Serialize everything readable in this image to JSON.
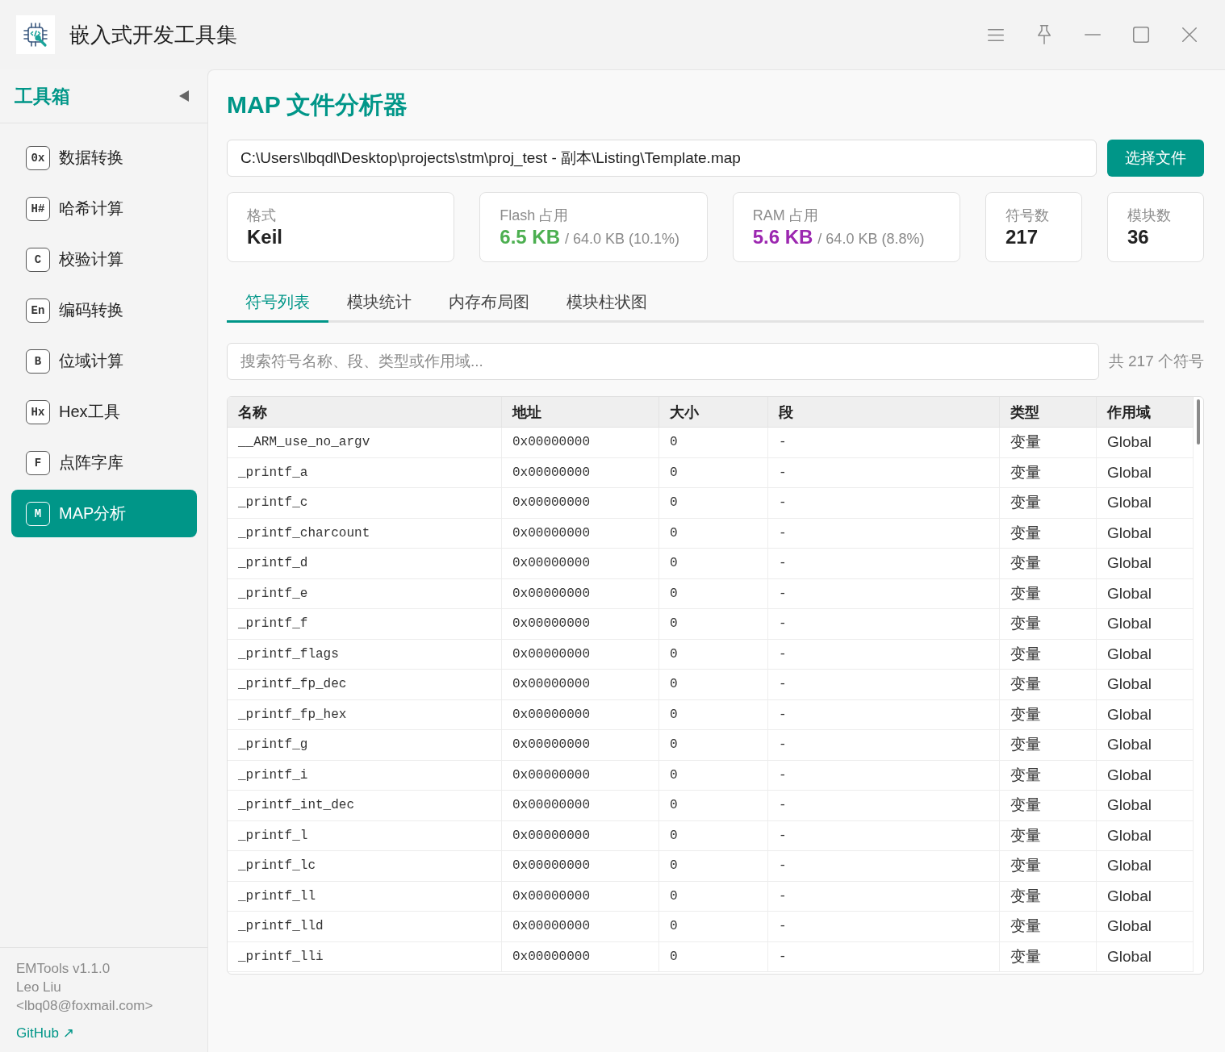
{
  "window": {
    "title": "嵌入式开发工具集"
  },
  "sidebar": {
    "title": "工具箱",
    "items": [
      {
        "badge": "0x",
        "label": "数据转换",
        "selected": false
      },
      {
        "badge": "H#",
        "label": "哈希计算",
        "selected": false
      },
      {
        "badge": "C",
        "label": "校验计算",
        "selected": false
      },
      {
        "badge": "En",
        "label": "编码转换",
        "selected": false
      },
      {
        "badge": "B",
        "label": "位域计算",
        "selected": false
      },
      {
        "badge": "Hx",
        "label": "Hex工具",
        "selected": false
      },
      {
        "badge": "F",
        "label": "点阵字库",
        "selected": false
      },
      {
        "badge": "M",
        "label": "MAP分析",
        "selected": true
      }
    ],
    "footer": {
      "version": "EMTools v1.1.0",
      "author": "Leo Liu",
      "email": "<lbq08@foxmail.com>",
      "link": "GitHub ↗"
    }
  },
  "main": {
    "title": "MAP 文件分析器",
    "file_path": "C:\\Users\\lbqdl\\Desktop\\projects\\stm\\proj_test - 副本\\Listing\\Template.map",
    "choose_button": "选择文件",
    "stats": [
      {
        "label": "格式",
        "value": "Keil",
        "color": "#222222"
      },
      {
        "label": "Flash 占用",
        "value": "6.5 KB",
        "detail": "/ 64.0 KB (10.1%)",
        "color": "#4caf50"
      },
      {
        "label": "RAM 占用",
        "value": "5.6 KB",
        "detail": "/ 64.0 KB (8.8%)",
        "color": "#9c27b0"
      },
      {
        "label": "符号数",
        "value": "217",
        "color": "#222222"
      },
      {
        "label": "模块数",
        "value": "36",
        "color": "#222222"
      }
    ],
    "tabs": [
      {
        "label": "符号列表",
        "selected": true
      },
      {
        "label": "模块统计",
        "selected": false
      },
      {
        "label": "内存布局图",
        "selected": false
      },
      {
        "label": "模块柱状图",
        "selected": false
      }
    ],
    "search": {
      "placeholder": "搜索符号名称、段、类型或作用域..."
    },
    "count": "共 217 个符号",
    "table": {
      "columns": [
        {
          "label": "名称",
          "kind": "code"
        },
        {
          "label": "地址",
          "kind": "code"
        },
        {
          "label": "大小",
          "kind": "code"
        },
        {
          "label": "段",
          "kind": "code"
        },
        {
          "label": "类型",
          "kind": "text"
        },
        {
          "label": "作用域",
          "kind": "text"
        }
      ],
      "rows": [
        [
          "__ARM_use_no_argv",
          "0x00000000",
          "0",
          "-",
          "变量",
          "Global"
        ],
        [
          "_printf_a",
          "0x00000000",
          "0",
          "-",
          "变量",
          "Global"
        ],
        [
          "_printf_c",
          "0x00000000",
          "0",
          "-",
          "变量",
          "Global"
        ],
        [
          "_printf_charcount",
          "0x00000000",
          "0",
          "-",
          "变量",
          "Global"
        ],
        [
          "_printf_d",
          "0x00000000",
          "0",
          "-",
          "变量",
          "Global"
        ],
        [
          "_printf_e",
          "0x00000000",
          "0",
          "-",
          "变量",
          "Global"
        ],
        [
          "_printf_f",
          "0x00000000",
          "0",
          "-",
          "变量",
          "Global"
        ],
        [
          "_printf_flags",
          "0x00000000",
          "0",
          "-",
          "变量",
          "Global"
        ],
        [
          "_printf_fp_dec",
          "0x00000000",
          "0",
          "-",
          "变量",
          "Global"
        ],
        [
          "_printf_fp_hex",
          "0x00000000",
          "0",
          "-",
          "变量",
          "Global"
        ],
        [
          "_printf_g",
          "0x00000000",
          "0",
          "-",
          "变量",
          "Global"
        ],
        [
          "_printf_i",
          "0x00000000",
          "0",
          "-",
          "变量",
          "Global"
        ],
        [
          "_printf_int_dec",
          "0x00000000",
          "0",
          "-",
          "变量",
          "Global"
        ],
        [
          "_printf_l",
          "0x00000000",
          "0",
          "-",
          "变量",
          "Global"
        ],
        [
          "_printf_lc",
          "0x00000000",
          "0",
          "-",
          "变量",
          "Global"
        ],
        [
          "_printf_ll",
          "0x00000000",
          "0",
          "-",
          "变量",
          "Global"
        ],
        [
          "_printf_lld",
          "0x00000000",
          "0",
          "-",
          "变量",
          "Global"
        ],
        [
          "_printf_lli",
          "0x00000000",
          "0",
          "-",
          "变量",
          "Global"
        ]
      ]
    }
  }
}
